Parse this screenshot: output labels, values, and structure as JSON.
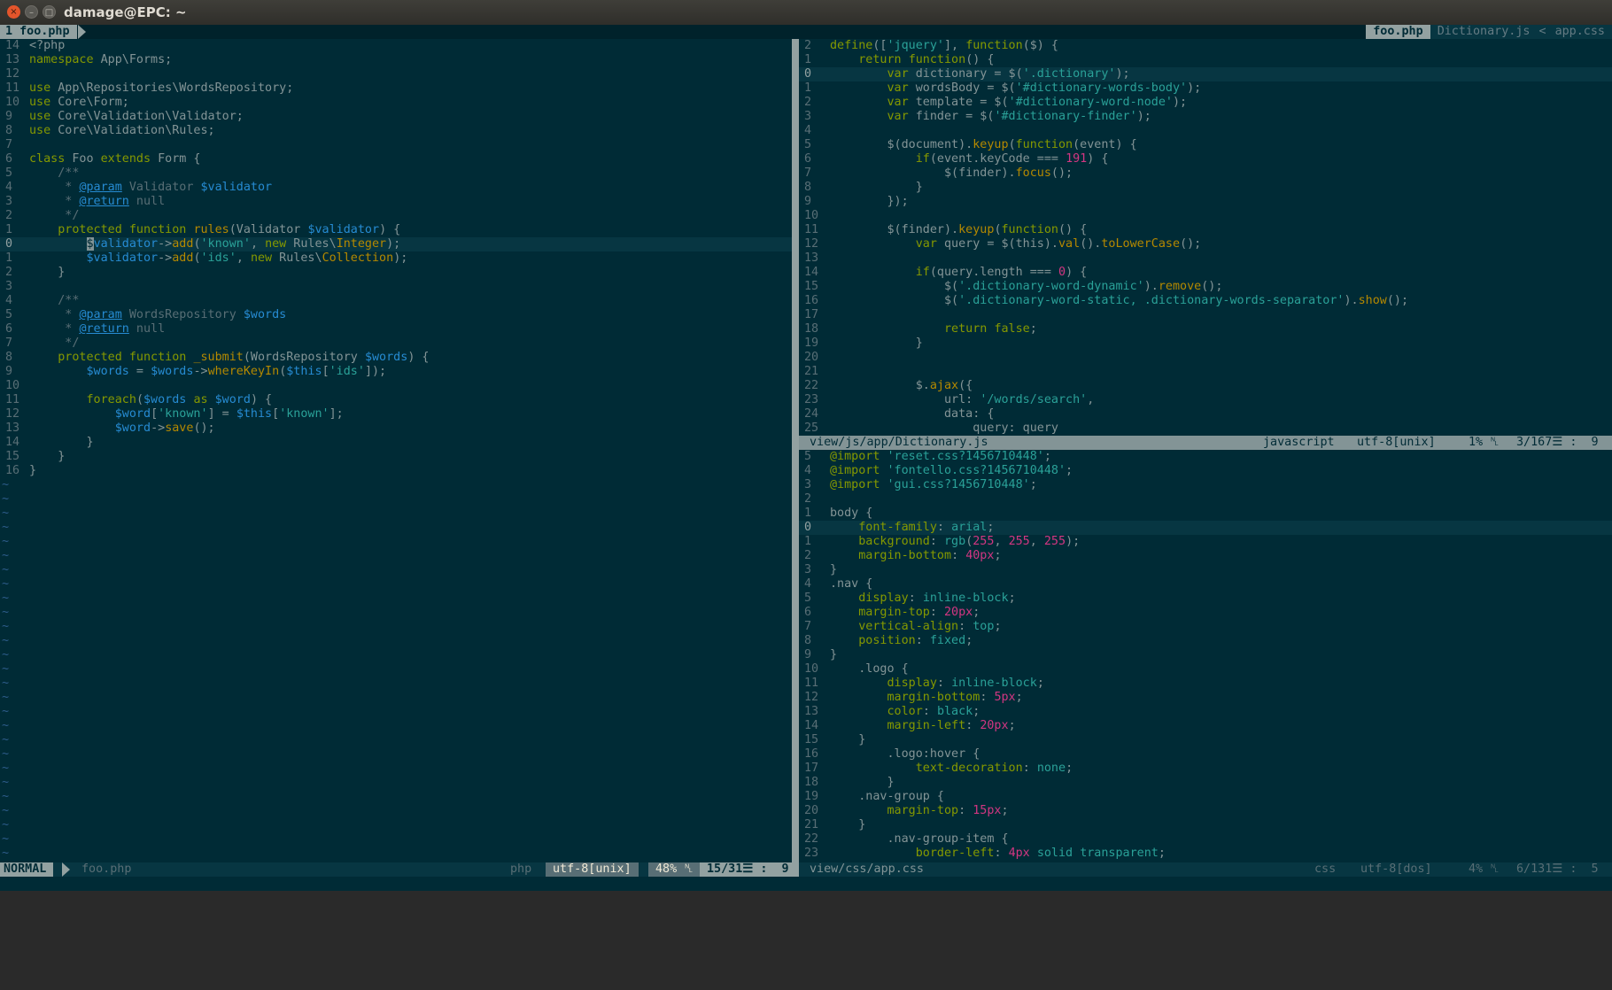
{
  "window": {
    "title": "damage@EPC: ~",
    "close_glyph": "×",
    "min_glyph": "–",
    "max_glyph": "□"
  },
  "tabline": {
    "left_tab": "1 foo.php",
    "right_active": "foo.php",
    "right_tab2": "Dictionary.js",
    "right_sep": "<",
    "right_tab3": "app.css"
  },
  "left_status": {
    "mode": "NORMAL",
    "file": "foo.php",
    "filetype": "php",
    "encoding": "utf-8[unix]",
    "percent": "48% ␤",
    "position": "15/31☰ :  9"
  },
  "right_top_status": {
    "file": "view/js/app/Dictionary.js",
    "filetype": "javascript",
    "encoding": "utf-8[unix]",
    "percent": "1% ␤",
    "position": "3/167☰ :  9"
  },
  "right_bottom_status": {
    "file": "view/css/app.css",
    "filetype": "css",
    "encoding": "utf-8[dos]",
    "percent": "4% ␤",
    "position": "6/131☰ :  5"
  },
  "tilde": "~",
  "php_lines": [
    {
      "n": "14",
      "t": "<?php"
    },
    {
      "n": "13",
      "t": "namespace App\\Forms;"
    },
    {
      "n": "12",
      "t": ""
    },
    {
      "n": "11",
      "t": "use App\\Repositories\\WordsRepository;"
    },
    {
      "n": "10",
      "t": "use Core\\Form;"
    },
    {
      "n": "9",
      "t": "use Core\\Validation\\Validator;"
    },
    {
      "n": "8",
      "t": "use Core\\Validation\\Rules;"
    },
    {
      "n": "7",
      "t": ""
    },
    {
      "n": "6",
      "t": "class Foo extends Form {"
    },
    {
      "n": "5",
      "t": "    /**"
    },
    {
      "n": "4",
      "t": "     * @param Validator $validator"
    },
    {
      "n": "3",
      "t": "     * @return null"
    },
    {
      "n": "2",
      "t": "     */"
    },
    {
      "n": "1",
      "t": "    protected function rules(Validator $validator) {"
    },
    {
      "n": "0",
      "t": "        $validator->add('known', new Rules\\Integer);"
    },
    {
      "n": "1",
      "t": "        $validator->add('ids', new Rules\\Collection);"
    },
    {
      "n": "2",
      "t": "    }"
    },
    {
      "n": "3",
      "t": ""
    },
    {
      "n": "4",
      "t": "    /**"
    },
    {
      "n": "5",
      "t": "     * @param WordsRepository $words"
    },
    {
      "n": "6",
      "t": "     * @return null"
    },
    {
      "n": "7",
      "t": "     */"
    },
    {
      "n": "8",
      "t": "    protected function _submit(WordsRepository $words) {"
    },
    {
      "n": "9",
      "t": "        $words = $words->whereKeyIn($this['ids']);"
    },
    {
      "n": "10",
      "t": ""
    },
    {
      "n": "11",
      "t": "        foreach($words as $word) {"
    },
    {
      "n": "12",
      "t": "            $word['known'] = $this['known'];"
    },
    {
      "n": "13",
      "t": "            $word->save();"
    },
    {
      "n": "14",
      "t": "        }"
    },
    {
      "n": "15",
      "t": "    }"
    },
    {
      "n": "16",
      "t": "}"
    }
  ],
  "js_lines": [
    {
      "n": "2",
      "t": "define(['jquery'], function($) {"
    },
    {
      "n": "1",
      "t": "    return function() {"
    },
    {
      "n": "0",
      "t": "        var dictionary = $('.dictionary');"
    },
    {
      "n": "1",
      "t": "        var wordsBody = $('#dictionary-words-body');"
    },
    {
      "n": "2",
      "t": "        var template = $('#dictionary-word-node');"
    },
    {
      "n": "3",
      "t": "        var finder = $('#dictionary-finder');"
    },
    {
      "n": "4",
      "t": ""
    },
    {
      "n": "5",
      "t": "        $(document).keyup(function(event) {"
    },
    {
      "n": "6",
      "t": "            if(event.keyCode === 191) {"
    },
    {
      "n": "7",
      "t": "                $(finder).focus();"
    },
    {
      "n": "8",
      "t": "            }"
    },
    {
      "n": "9",
      "t": "        });"
    },
    {
      "n": "10",
      "t": ""
    },
    {
      "n": "11",
      "t": "        $(finder).keyup(function() {"
    },
    {
      "n": "12",
      "t": "            var query = $(this).val().toLowerCase();"
    },
    {
      "n": "13",
      "t": ""
    },
    {
      "n": "14",
      "t": "            if(query.length === 0) {"
    },
    {
      "n": "15",
      "t": "                $('.dictionary-word-dynamic').remove();"
    },
    {
      "n": "16",
      "t": "                $('.dictionary-word-static, .dictionary-words-separator').show();"
    },
    {
      "n": "17",
      "t": ""
    },
    {
      "n": "18",
      "t": "                return false;"
    },
    {
      "n": "19",
      "t": "            }"
    },
    {
      "n": "20",
      "t": ""
    },
    {
      "n": "21",
      "t": ""
    },
    {
      "n": "22",
      "t": "            $.ajax({"
    },
    {
      "n": "23",
      "t": "                url: '/words/search',"
    },
    {
      "n": "24",
      "t": "                data: {"
    },
    {
      "n": "25",
      "t": "                    query: query"
    }
  ],
  "css_lines": [
    {
      "n": "5",
      "t": "@import 'reset.css?1456710448';"
    },
    {
      "n": "4",
      "t": "@import 'fontello.css?1456710448';"
    },
    {
      "n": "3",
      "t": "@import 'gui.css?1456710448';"
    },
    {
      "n": "2",
      "t": ""
    },
    {
      "n": "1",
      "t": "body {"
    },
    {
      "n": "0",
      "t": "    font-family: arial;"
    },
    {
      "n": "1",
      "t": "    background: rgb(255, 255, 255);"
    },
    {
      "n": "2",
      "t": "    margin-bottom: 40px;"
    },
    {
      "n": "3",
      "t": "}"
    },
    {
      "n": "4",
      "t": ".nav {"
    },
    {
      "n": "5",
      "t": "    display: inline-block;"
    },
    {
      "n": "6",
      "t": "    margin-top: 20px;"
    },
    {
      "n": "7",
      "t": "    vertical-align: top;"
    },
    {
      "n": "8",
      "t": "    position: fixed;"
    },
    {
      "n": "9",
      "t": "}"
    },
    {
      "n": "10",
      "t": "    .logo {"
    },
    {
      "n": "11",
      "t": "        display: inline-block;"
    },
    {
      "n": "12",
      "t": "        margin-bottom: 5px;"
    },
    {
      "n": "13",
      "t": "        color: black;"
    },
    {
      "n": "14",
      "t": "        margin-left: 20px;"
    },
    {
      "n": "15",
      "t": "    }"
    },
    {
      "n": "16",
      "t": "        .logo:hover {"
    },
    {
      "n": "17",
      "t": "            text-decoration: none;"
    },
    {
      "n": "18",
      "t": "        }"
    },
    {
      "n": "19",
      "t": "    .nav-group {"
    },
    {
      "n": "20",
      "t": "        margin-top: 15px;"
    },
    {
      "n": "21",
      "t": "    }"
    },
    {
      "n": "22",
      "t": "        .nav-group-item {"
    },
    {
      "n": "23",
      "t": "            border-left: 4px solid transparent;"
    }
  ],
  "colors": {
    "background": "#002b36",
    "keyword": "#859900",
    "string": "#2aa198",
    "number": "#d33682",
    "variable": "#268bd2",
    "function": "#b58900",
    "comment": "#586e75"
  }
}
